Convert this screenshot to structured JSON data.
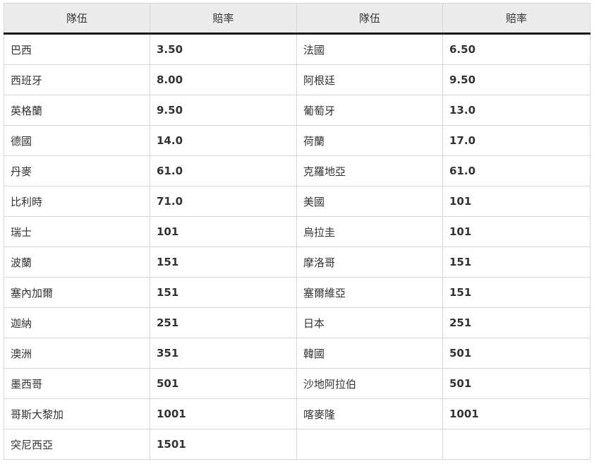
{
  "header": {
    "team_label_1": "隊伍",
    "odds_label_1": "賠率",
    "team_label_2": "隊伍",
    "odds_label_2": "賠率"
  },
  "rows": [
    {
      "team1": "巴西",
      "odds1": "3.50",
      "team2": "法國",
      "odds2": "6.50"
    },
    {
      "team1": "西班牙",
      "odds1": "8.00",
      "team2": "阿根廷",
      "odds2": "9.50"
    },
    {
      "team1": "英格蘭",
      "odds1": "9.50",
      "team2": "葡萄牙",
      "odds2": "13.0"
    },
    {
      "team1": "德國",
      "odds1": "14.0",
      "team2": "荷蘭",
      "odds2": "17.0"
    },
    {
      "team1": "丹麥",
      "odds1": "61.0",
      "team2": "克羅地亞",
      "odds2": "61.0"
    },
    {
      "team1": "比利時",
      "odds1": "71.0",
      "team2": "美國",
      "odds2": "101"
    },
    {
      "team1": "瑞士",
      "odds1": "101",
      "team2": "烏拉圭",
      "odds2": "101"
    },
    {
      "team1": "波蘭",
      "odds1": "151",
      "team2": "摩洛哥",
      "odds2": "151"
    },
    {
      "team1": "塞內加爾",
      "odds1": "151",
      "team2": "塞爾維亞",
      "odds2": "151"
    },
    {
      "team1": "迦納",
      "odds1": "251",
      "team2": "日本",
      "odds2": "251"
    },
    {
      "team1": "澳洲",
      "odds1": "351",
      "team2": "韓國",
      "odds2": "501"
    },
    {
      "team1": "墨西哥",
      "odds1": "501",
      "team2": "沙地阿拉伯",
      "odds2": "501"
    },
    {
      "team1": "哥斯大黎加",
      "odds1": "1001",
      "team2": "喀麥隆",
      "odds2": "1001"
    },
    {
      "team1": "突尼西亞",
      "odds1": "1501",
      "team2": "",
      "odds2": ""
    }
  ]
}
